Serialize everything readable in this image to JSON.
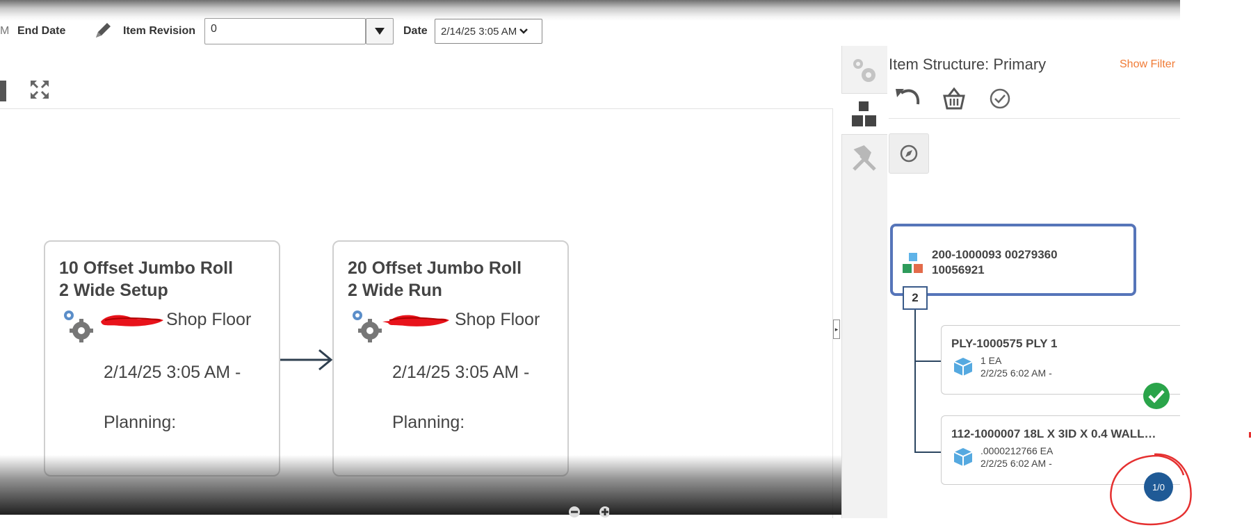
{
  "toolbar": {
    "truncated_prefix": "M",
    "end_date_label": "End Date",
    "item_revision_label": "Item Revision",
    "item_revision_value": "0",
    "date_label": "Date",
    "date_value": "2/14/25 3:05 AM"
  },
  "operations": [
    {
      "title_line1": "10 Offset Jumbo Roll",
      "title_line2": "2 Wide Setup",
      "work_center": "Shop Floor",
      "date": "2/14/25 3:05 AM -",
      "planning": "Planning:"
    },
    {
      "title_line1": "20 Offset Jumbo Roll",
      "title_line2": "2 Wide Run",
      "work_center": "Shop Floor",
      "date": "2/14/25 3:05 AM -",
      "planning": "Planning:"
    }
  ],
  "panel": {
    "title": "Item Structure: Primary",
    "show_filter": "Show Filter",
    "root": {
      "line1": "200-1000093 00279360",
      "line2": "10056921",
      "child_count": "2"
    },
    "children": [
      {
        "title": "PLY-1000575 PLY 1",
        "qty": "1 EA",
        "date": "2/2/25 6:02 AM -"
      },
      {
        "title": "112-1000007 18L X 3ID X 0.4 WALL…",
        "qty": ".0000212766 EA",
        "date": "2/2/25 6:02 AM -"
      }
    ],
    "page_badge": "1/0"
  },
  "colors": {
    "accent_blue": "#5675b9",
    "filter_orange": "#f07b36",
    "badge_blue": "#1f5a96",
    "check_green": "#2aa44a",
    "annotation_red": "#e53030"
  }
}
